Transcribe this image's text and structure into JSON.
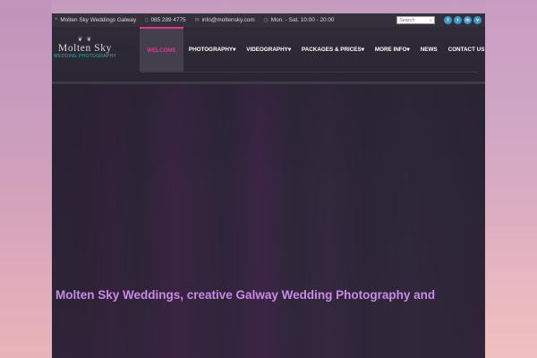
{
  "topbar": {
    "location": "Molten Sky Weddings Galway",
    "phone": "085 289 4775",
    "email": "info@moltensky.com",
    "hours": "Mon. - Sat. 10:00 - 20:00",
    "search_placeholder": "Search",
    "social": [
      {
        "icon": "facebook-icon",
        "label": "f"
      },
      {
        "icon": "twitter-icon",
        "label": "t"
      },
      {
        "icon": "linkedin-icon",
        "label": "in"
      },
      {
        "icon": "vimeo-icon",
        "label": "v"
      }
    ]
  },
  "logo": {
    "name": "Molten Sky",
    "tagline": "WEDDING PHOTOGRAPHY"
  },
  "nav": {
    "items": [
      {
        "label": "WELCOME",
        "active": true
      },
      {
        "label": "PHOTOGRAPHY▾"
      },
      {
        "label": "VIDEOGRAPHY▾"
      },
      {
        "label": "PACKAGES & PRICES▾"
      },
      {
        "label": "MORE INFO▾"
      },
      {
        "label": "NEWS"
      },
      {
        "label": "CONTACT US"
      }
    ]
  },
  "hero": {
    "title": "Molten Sky Weddings, creative Galway Wedding Photography and"
  },
  "colors": {
    "accent": "#e2358e",
    "title": "#c98ae6",
    "tagline": "#2fb7a9",
    "social": "#3a9cc7"
  }
}
